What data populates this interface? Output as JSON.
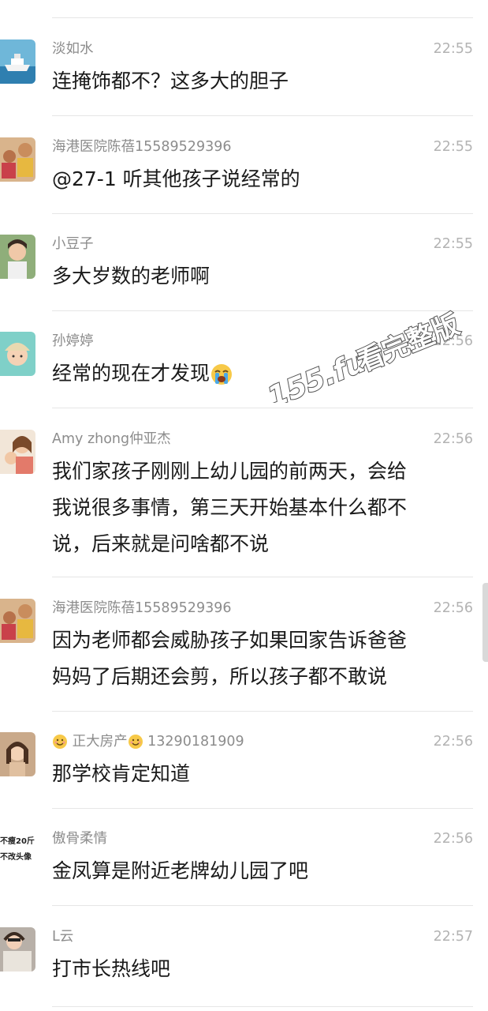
{
  "messages": [
    {
      "name": "淡如水",
      "time": "22:55",
      "text": [
        "连掩饰都不？这多大的胆子"
      ]
    },
    {
      "name": "海港医院陈蓓15589529396",
      "time": "22:55",
      "text": [
        "@27-1 听其他孩子说经常的"
      ]
    },
    {
      "name": "小豆子",
      "time": "22:55",
      "text": [
        "多大岁数的老师啊"
      ]
    },
    {
      "name": "孙婷婷",
      "time": "22:56",
      "text": [
        "经常的现在才发现"
      ]
    },
    {
      "name": "Amy zhong仲亚杰",
      "time": "22:56",
      "text": [
        "我们家孩子刚刚上幼儿园的前两天，会给",
        "我说很多事情，第三天开始基本什么都不",
        "说，后来就是问啥都不说"
      ]
    },
    {
      "name": "海港医院陈蓓15589529396",
      "time": "22:56",
      "text": [
        "因为老师都会威胁孩子如果回家告诉爸爸",
        "妈妈了后期还会剪，所以孩子都不敢说"
      ]
    },
    {
      "name": "正大房产",
      "name_suffix": "13290181909",
      "time": "22:56",
      "text": [
        "那学校肯定知道"
      ]
    },
    {
      "name": "傲骨柔情",
      "time": "22:56",
      "text": [
        "金凤算是附近老牌幼儿园了吧"
      ],
      "avatar_text": [
        "不瘦20斤",
        "不改头像"
      ]
    },
    {
      "name": "L云",
      "time": "22:57",
      "text": [
        "打市长热线吧"
      ]
    }
  ],
  "watermark": {
    "domain": "155.fun",
    "suffix": "看完整版"
  },
  "icons": {
    "crying_emoji": "crying-face-icon",
    "smile_emoji": "smiling-face-icon"
  }
}
